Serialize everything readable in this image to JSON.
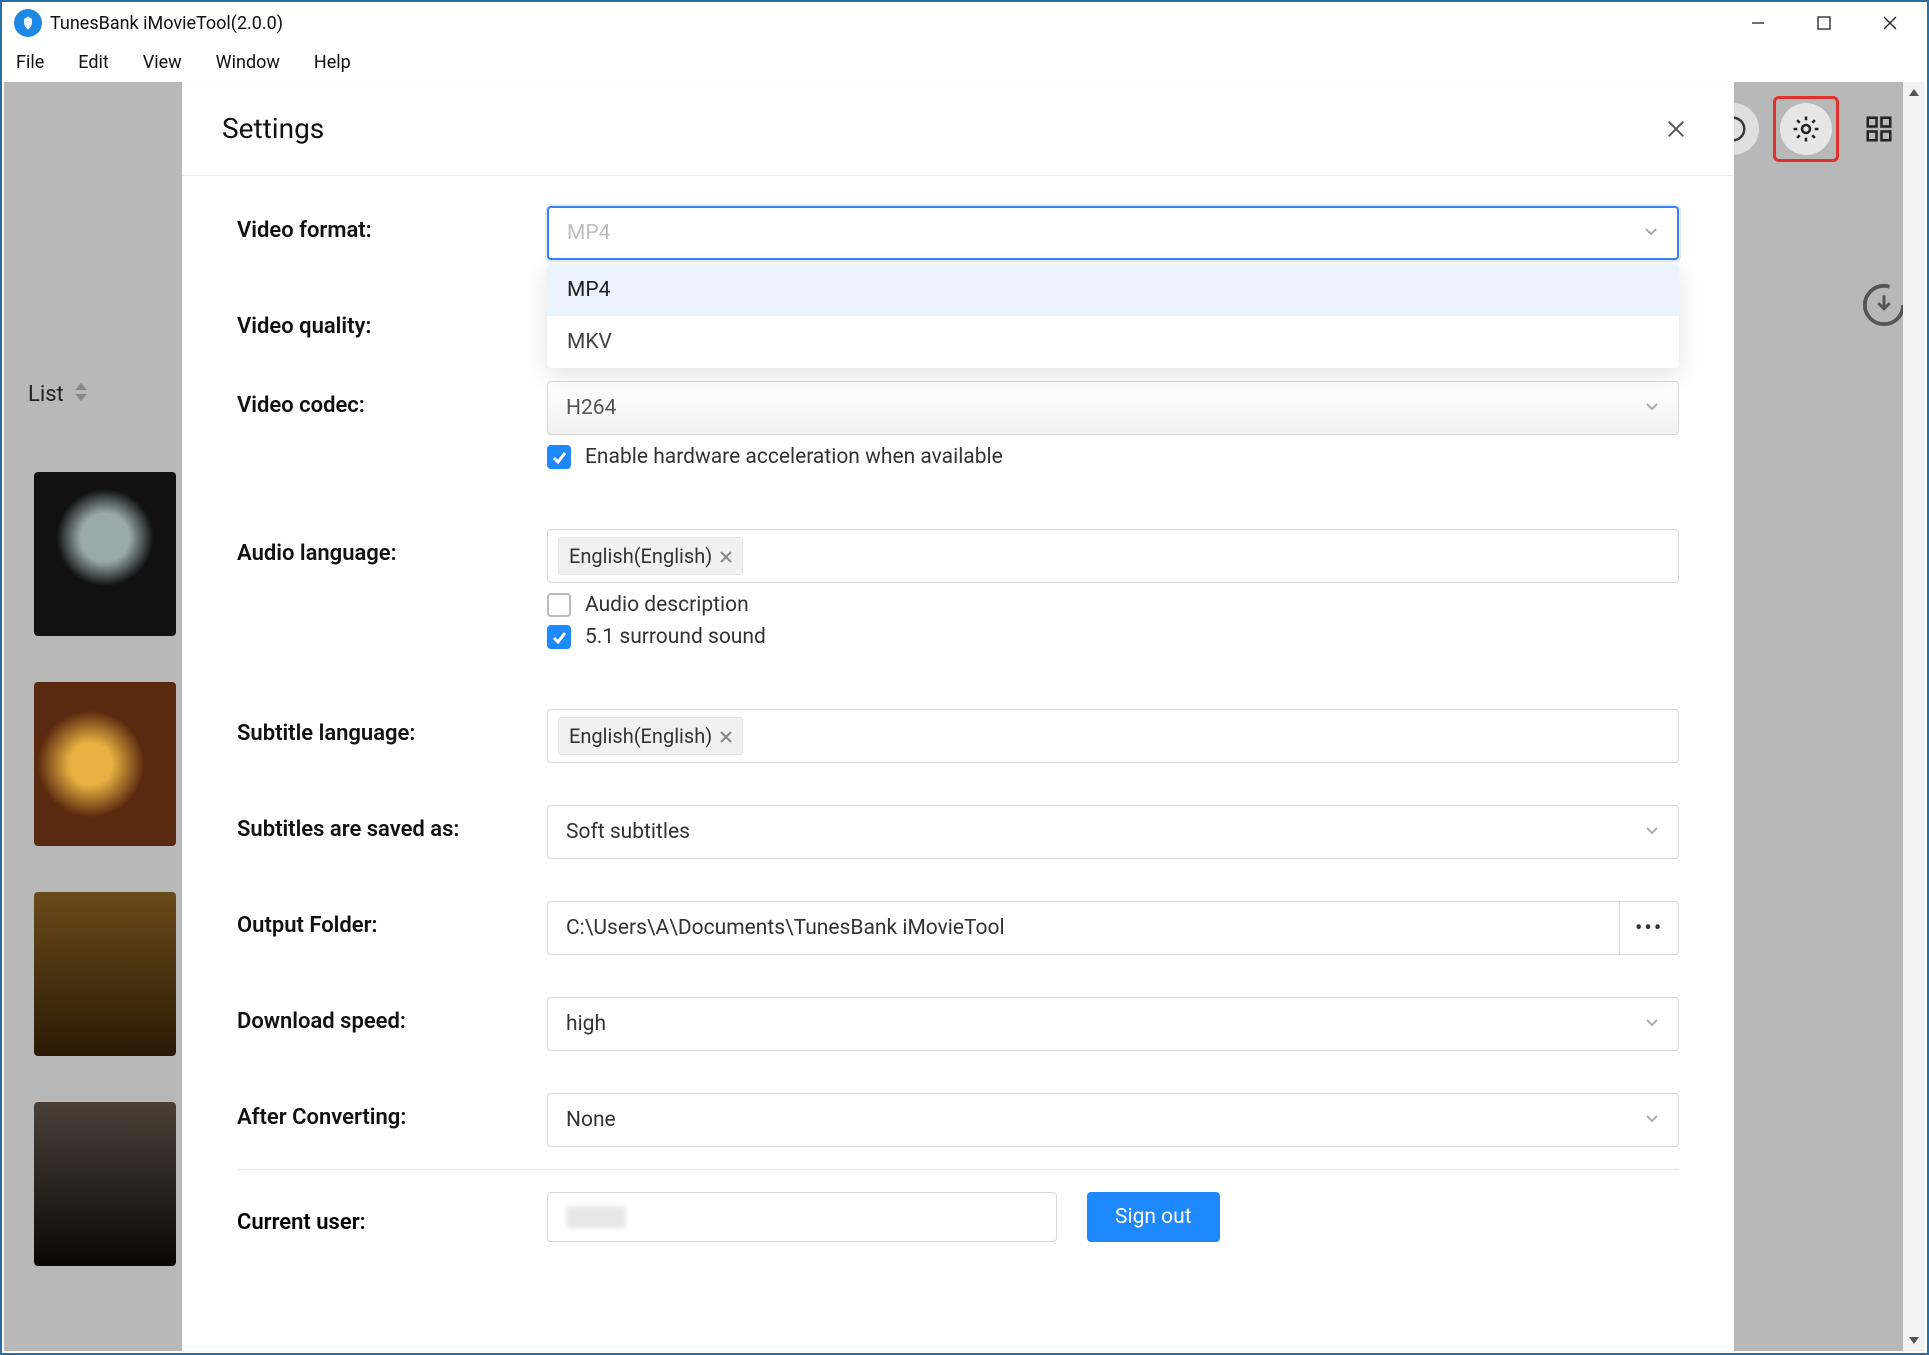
{
  "title": "TunesBank iMovieTool(2.0.0)",
  "menus": {
    "file": "File",
    "edit": "Edit",
    "view": "View",
    "window": "Window",
    "help": "Help"
  },
  "background": {
    "list_label": "List"
  },
  "modal": {
    "title": "Settings",
    "labels": {
      "video_format": "Video format:",
      "video_quality": "Video quality:",
      "video_codec": "Video codec:",
      "audio_language": "Audio language:",
      "subtitle_language": "Subtitle language:",
      "subtitles_saved_as": "Subtitles are saved as:",
      "output_folder": "Output Folder:",
      "download_speed": "Download speed:",
      "after_converting": "After Converting:",
      "current_user": "Current user:"
    },
    "video_format": {
      "placeholder": "MP4",
      "options": [
        "MP4",
        "MKV"
      ]
    },
    "video_codec": {
      "value": "H264",
      "hw_accel_label": "Enable hardware acceleration when available",
      "hw_accel_checked": true
    },
    "audio": {
      "tag": "English(English)",
      "audio_description_label": "Audio description",
      "audio_description_checked": false,
      "surround_label": "5.1 surround sound",
      "surround_checked": true
    },
    "subtitle": {
      "tag": "English(English)"
    },
    "subtitles_saved_as": "Soft subtitles",
    "output_folder": "C:\\Users\\A\\Documents\\TunesBank iMovieTool",
    "download_speed": "high",
    "after_converting": "None",
    "sign_out": "Sign out"
  }
}
